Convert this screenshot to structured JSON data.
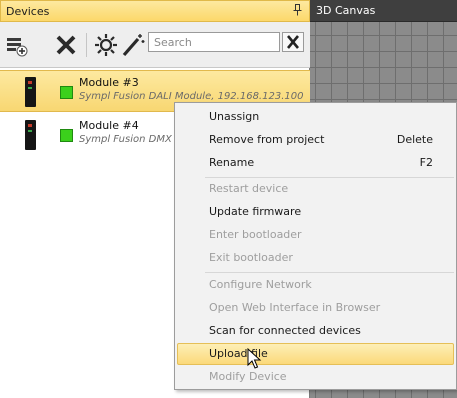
{
  "devices_panel": {
    "title": "Devices",
    "pin_glyph": "ᵖ",
    "toolbar": {
      "add_device_icon": "add-device-icon",
      "remove_icon": "remove-icon",
      "scan_icon": "scan-icon",
      "wand_icon": "magic-wand-icon",
      "search_placeholder": "Search",
      "clear_icon": "clear-icon"
    },
    "devices": [
      {
        "name": "Module #3",
        "description": "Sympl Fusion DALI Module, 192.168.123.100",
        "status_color": "#3bd01c",
        "selected": true
      },
      {
        "name": "Module #4",
        "description": "Sympl Fusion DMX Module",
        "status_color": "#3bd01c",
        "selected": false
      }
    ]
  },
  "canvas_panel": {
    "title": "3D Canvas"
  },
  "context_menu": {
    "items": [
      {
        "label": "Unassign",
        "shortcut": "",
        "enabled": true
      },
      {
        "label": "Remove from project",
        "shortcut": "Delete",
        "enabled": true
      },
      {
        "label": "Rename",
        "shortcut": "F2",
        "enabled": true
      },
      {
        "label": "Restart device",
        "shortcut": "",
        "enabled": false
      },
      {
        "label": "Update firmware",
        "shortcut": "",
        "enabled": true
      },
      {
        "label": "Enter bootloader",
        "shortcut": "",
        "enabled": false
      },
      {
        "label": "Exit bootloader",
        "shortcut": "",
        "enabled": false
      },
      {
        "label": "Configure Network",
        "shortcut": "",
        "enabled": false
      },
      {
        "label": "Open Web Interface in Browser",
        "shortcut": "",
        "enabled": false
      },
      {
        "label": "Scan for connected devices",
        "shortcut": "",
        "enabled": true
      },
      {
        "label": "Upload file",
        "shortcut": "",
        "enabled": true,
        "hovered": true
      },
      {
        "label": "Modify Device",
        "shortcut": "",
        "enabled": false
      }
    ]
  },
  "colors": {
    "accent_highlight": "#fcd86a",
    "status_online": "#3bd01c",
    "canvas_background": "#8b8b8b"
  }
}
